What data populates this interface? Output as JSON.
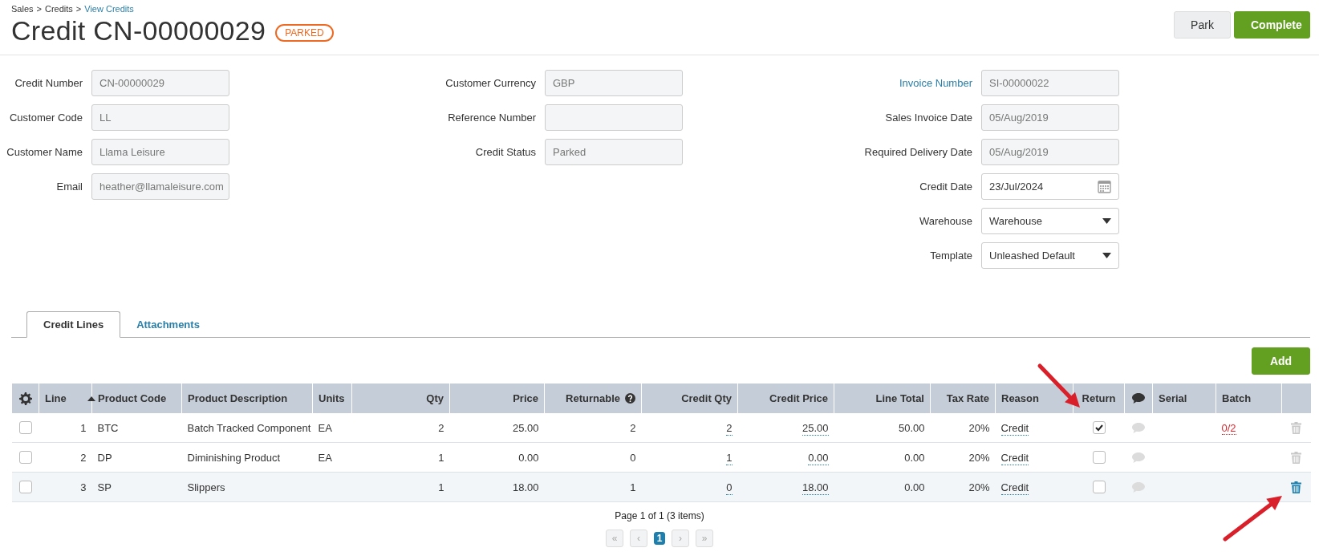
{
  "breadcrumb": [
    {
      "label": "Sales",
      "link": false
    },
    {
      "label": ">",
      "link": false
    },
    {
      "label": "Credits",
      "link": false
    },
    {
      "label": ">",
      "link": false
    },
    {
      "label": "View Credits",
      "link": true
    }
  ],
  "title": "Credit CN-00000029",
  "status_badge": "PARKED",
  "actions": [
    {
      "label": "Park",
      "kind": "secondary"
    },
    {
      "label": "Complete",
      "kind": "primary"
    }
  ],
  "form_columns": [
    [
      {
        "label": "Credit Number",
        "value": "CN-00000029",
        "kind": "readonly",
        "link": false
      },
      {
        "label": "Customer Code",
        "value": "LL",
        "kind": "readonly",
        "link": false
      },
      {
        "label": "Customer Name",
        "value": "Llama Leisure",
        "kind": "readonly",
        "link": false
      },
      {
        "label": "Email",
        "value": "heather@llamaleisure.com",
        "kind": "readonly",
        "link": false
      }
    ],
    [
      {
        "label": "Customer Currency",
        "value": "GBP",
        "kind": "readonly",
        "link": false
      },
      {
        "label": "Reference Number",
        "kind": "readonly",
        "link": false
      },
      {
        "label": "Credit Status",
        "value": "Parked",
        "kind": "readonly",
        "link": false
      }
    ],
    [
      {
        "label": "Invoice Number",
        "value": "SI-00000022",
        "kind": "readonly",
        "link": true
      },
      {
        "label": "Sales Invoice Date",
        "value": "05/Aug/2019",
        "kind": "readonly",
        "link": false
      },
      {
        "label": "Required Delivery Date",
        "value": "05/Aug/2019",
        "kind": "readonly",
        "link": false
      },
      {
        "label": "Credit Date",
        "value": "23/Jul/2024",
        "kind": "date",
        "link": false
      },
      {
        "label": "Warehouse",
        "value": "Warehouse",
        "kind": "select",
        "link": false
      },
      {
        "label": "Template",
        "value": "Unleashed Default",
        "kind": "select",
        "link": false
      }
    ]
  ],
  "tabs": [
    {
      "label": "Credit Lines",
      "selected": true
    },
    {
      "label": "Attachments",
      "selected": false
    }
  ],
  "add_button": "Add",
  "table": {
    "columns": [
      {
        "kind": "settings"
      },
      {
        "label": "Line",
        "kind": "sort"
      },
      {
        "label": "Product Code",
        "kind": "text"
      },
      {
        "label": "Product Description",
        "kind": "text"
      },
      {
        "label": "Units",
        "kind": "text"
      },
      {
        "label": "Qty",
        "kind": "num"
      },
      {
        "label": "Price",
        "kind": "num"
      },
      {
        "label": "Returnable",
        "kind": "help"
      },
      {
        "label": "Credit Qty",
        "kind": "num"
      },
      {
        "label": "Credit Price",
        "kind": "num"
      },
      {
        "label": "Line Total",
        "kind": "num"
      },
      {
        "label": "Tax Rate",
        "kind": "num"
      },
      {
        "label": "Reason",
        "kind": "text"
      },
      {
        "label": "Return",
        "kind": "center"
      },
      {
        "kind": "comment"
      },
      {
        "label": "Serial",
        "kind": "text"
      },
      {
        "label": "Batch",
        "kind": "text"
      },
      {
        "kind": "blank"
      }
    ],
    "rows": [
      {
        "selected": false,
        "highlighted": false,
        "line": "1",
        "product_code": "BTC",
        "description": "Batch Tracked Component",
        "units": "EA",
        "qty": "2",
        "price": "25.00",
        "returnable": "2",
        "credit_qty": "2",
        "credit_price": "25.00",
        "line_total": "50.00",
        "tax_rate": "20%",
        "reason": "Credit",
        "return": true,
        "batch": "0/2"
      },
      {
        "selected": false,
        "highlighted": false,
        "line": "2",
        "product_code": "DP",
        "description": "Diminishing Product",
        "units": "EA",
        "qty": "1",
        "price": "0.00",
        "returnable": "0",
        "credit_qty": "1",
        "credit_price": "0.00",
        "line_total": "0.00",
        "tax_rate": "20%",
        "reason": "Credit",
        "return": false
      },
      {
        "selected": false,
        "highlighted": true,
        "line": "3",
        "product_code": "SP",
        "description": "Slippers",
        "qty": "1",
        "price": "18.00",
        "returnable": "1",
        "credit_qty": "0",
        "credit_price": "18.00",
        "line_total": "0.00",
        "tax_rate": "20%",
        "reason": "Credit",
        "return": false
      }
    ]
  },
  "pagination": {
    "summary": "Page 1 of 1 (3 items)",
    "buttons": [
      {
        "label": "«",
        "disabled": true,
        "selected": false
      },
      {
        "label": "‹",
        "disabled": true,
        "selected": false
      },
      {
        "label": "1",
        "disabled": false,
        "selected": true
      },
      {
        "label": "›",
        "disabled": true,
        "selected": false
      },
      {
        "label": "»",
        "disabled": true,
        "selected": false
      }
    ]
  }
}
